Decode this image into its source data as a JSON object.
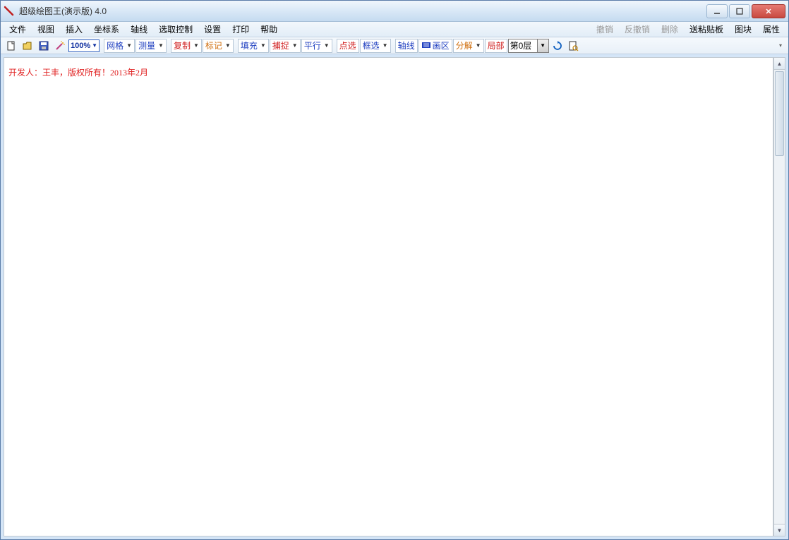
{
  "window": {
    "title": "超级绘图王(演示版) 4.0"
  },
  "menubar": {
    "left": [
      {
        "label": "文件"
      },
      {
        "label": "视图"
      },
      {
        "label": "插入"
      },
      {
        "label": "坐标系"
      },
      {
        "label": "轴线"
      },
      {
        "label": "选取控制"
      },
      {
        "label": "设置"
      },
      {
        "label": "打印"
      },
      {
        "label": "帮助"
      }
    ],
    "right": [
      {
        "label": "撤销",
        "disabled": true
      },
      {
        "label": "反撤销",
        "disabled": true
      },
      {
        "label": "删除",
        "disabled": true
      },
      {
        "label": "送粘贴板",
        "disabled": false
      },
      {
        "label": "图块",
        "disabled": false
      },
      {
        "label": "属性",
        "disabled": false
      }
    ]
  },
  "toolbar": {
    "zoom": "100%",
    "groups": [
      {
        "label": "网格",
        "color": "c-blue"
      },
      {
        "label": "测量",
        "color": "c-blue"
      },
      {
        "label": "复制",
        "color": "c-red"
      },
      {
        "label": "标记",
        "color": "c-orange"
      },
      {
        "label": "填充",
        "color": "c-blue"
      },
      {
        "label": "捕捉",
        "color": "c-red"
      },
      {
        "label": "平行",
        "color": "c-blue"
      },
      {
        "label": "点选",
        "color": "c-red"
      },
      {
        "label": "框选",
        "color": "c-blue"
      },
      {
        "label": "轴线",
        "color": "c-blue"
      },
      {
        "label": "画区",
        "color": "c-blue"
      },
      {
        "label": "分解",
        "color": "c-orange"
      },
      {
        "label": "局部",
        "color": "c-red"
      }
    ],
    "layer": "第0层"
  },
  "canvas": {
    "notice": "开发人：王丰，版权所有！2013年2月"
  }
}
